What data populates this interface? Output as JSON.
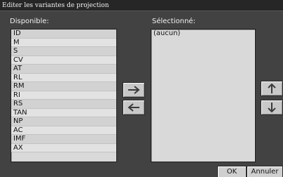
{
  "window": {
    "title": "Editer les variantes de projection"
  },
  "available": {
    "label": "Disponible:",
    "items": [
      "ID",
      "M",
      "S",
      "CV",
      "AT",
      "RL",
      "RM",
      "RI",
      "RS",
      "TAN",
      "NP",
      "AC",
      "IMF",
      "AX"
    ]
  },
  "selected": {
    "label": "Sélectionné:",
    "items": [
      "(aucun)"
    ]
  },
  "buttons": {
    "add_icon": "arrow-right-icon",
    "remove_icon": "arrow-left-icon",
    "move_up_icon": "arrow-up-icon",
    "move_down_icon": "arrow-down-icon",
    "ok": "OK",
    "cancel": "Annuler"
  }
}
